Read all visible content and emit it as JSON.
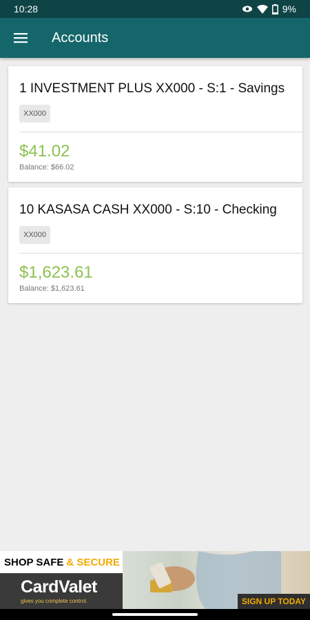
{
  "status_bar": {
    "time": "10:28",
    "battery": "9%",
    "icons": [
      "eye-icon",
      "wifi-icon",
      "battery-icon"
    ]
  },
  "app_bar": {
    "title": "Accounts",
    "menu_icon": "hamburger-menu-icon"
  },
  "accounts": [
    {
      "name": "1 INVESTMENT PLUS XX000 - S:1 - Savings",
      "chip": "XX000",
      "available": "$41.02",
      "balance": "Balance: $66.02"
    },
    {
      "name": "10 KASASA CASH XX000 - S:10 - Checking",
      "chip": "XX000",
      "available": "$1,623.61",
      "balance": "Balance: $1,623.61"
    }
  ],
  "ad": {
    "headline_part1": "SHOP SAFE",
    "headline_part2": "& SECURE",
    "brand": "CardValet",
    "tagline": "gives you complete control.",
    "cta": "SIGN UP TODAY"
  },
  "colors": {
    "status_bar": "#0f4447",
    "app_bar": "#15666a",
    "amount": "#8cc152",
    "background": "#eeeeee"
  }
}
